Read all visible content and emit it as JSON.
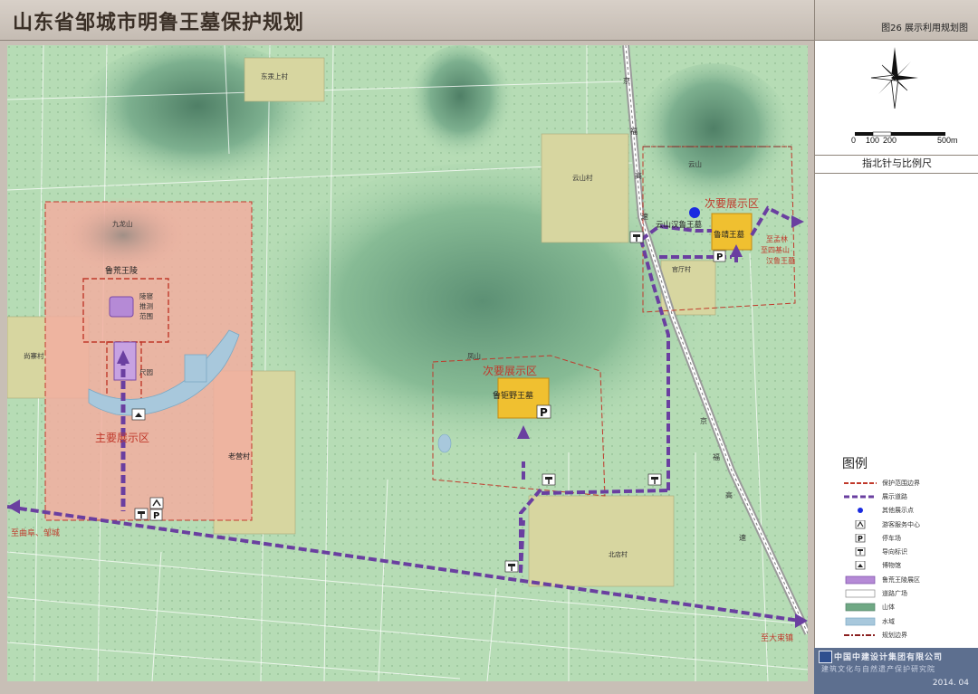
{
  "header": {
    "title": "山东省邹城市明鲁王墓保护规划"
  },
  "figure": {
    "label": "图26  展示利用规划图"
  },
  "compass": {
    "scale_ticks": [
      "0",
      "100",
      "200",
      "500m"
    ],
    "caption": "指北针与比例尺"
  },
  "map": {
    "places": {
      "dongxiang": "东汞上村",
      "jiulongshan": "九龙山",
      "luhuang_ling": "鲁荒王陵",
      "lingqin": "陵寝推测范围",
      "lingqin_lines": [
        "陵寝",
        "推测",
        "范围"
      ],
      "shangchi": "尚寨村",
      "zhuan": "尺园",
      "main_zone": "主要展示区",
      "laoying": "老营村",
      "fengshan": "凤山",
      "sec_zone_center": "次要展示区",
      "lu_juye": "鲁钜野王墓",
      "yunshan_village": "云山村",
      "yunshan": "云山",
      "sec_zone_ne": "次要展示区",
      "yunshan_han": "云山汉鲁王墓",
      "lu_jing": "鲁靖王墓",
      "guanzhuang": "官厅村",
      "to_menglin": [
        "至孟林",
        "至四基山",
        "汉鲁王墓"
      ],
      "to_qufu": "至曲阜、邹城",
      "to_dabao": "至大束镇",
      "beidian": "北店村",
      "railway_chars": [
        "京",
        "福",
        "高",
        "速"
      ],
      "railway_chars_s": [
        "京",
        "福",
        "高",
        "速"
      ]
    },
    "parking_label": "P"
  },
  "legend": {
    "title": "图例",
    "items": [
      {
        "label": "保护范围边界",
        "icon": "red-dashed-line"
      },
      {
        "label": "展示道路",
        "icon": "purple-dashed-line"
      },
      {
        "label": "其他展示点",
        "icon": "blue-dot"
      },
      {
        "label": "游客服务中心",
        "icon": "service-center-icon"
      },
      {
        "label": "停车场",
        "icon": "parking-icon"
      },
      {
        "label": "导向标识",
        "icon": "signpost-icon"
      },
      {
        "label": "博物馆",
        "icon": "museum-icon"
      },
      {
        "label": "鲁荒王陵展区",
        "icon": "purple-box"
      },
      {
        "label": "道路广场",
        "icon": "white-box"
      },
      {
        "label": "山体",
        "icon": "mountain-swatch"
      },
      {
        "label": "水域",
        "icon": "water-swatch"
      },
      {
        "label": "规划边界",
        "icon": "dashdot-line"
      }
    ]
  },
  "footer": {
    "company": "中国中建设计集团有限公司",
    "institute": "建筑文化与自然遗产保护研究院",
    "date": "2014. 04"
  },
  "colors": {
    "protection": "#c0392b",
    "route": "#6a3fa0",
    "zone_fill": "#f3b0a0",
    "tomb": "#f0c030",
    "map_base": "#b4dcb4",
    "mountain": "#6fa884"
  }
}
